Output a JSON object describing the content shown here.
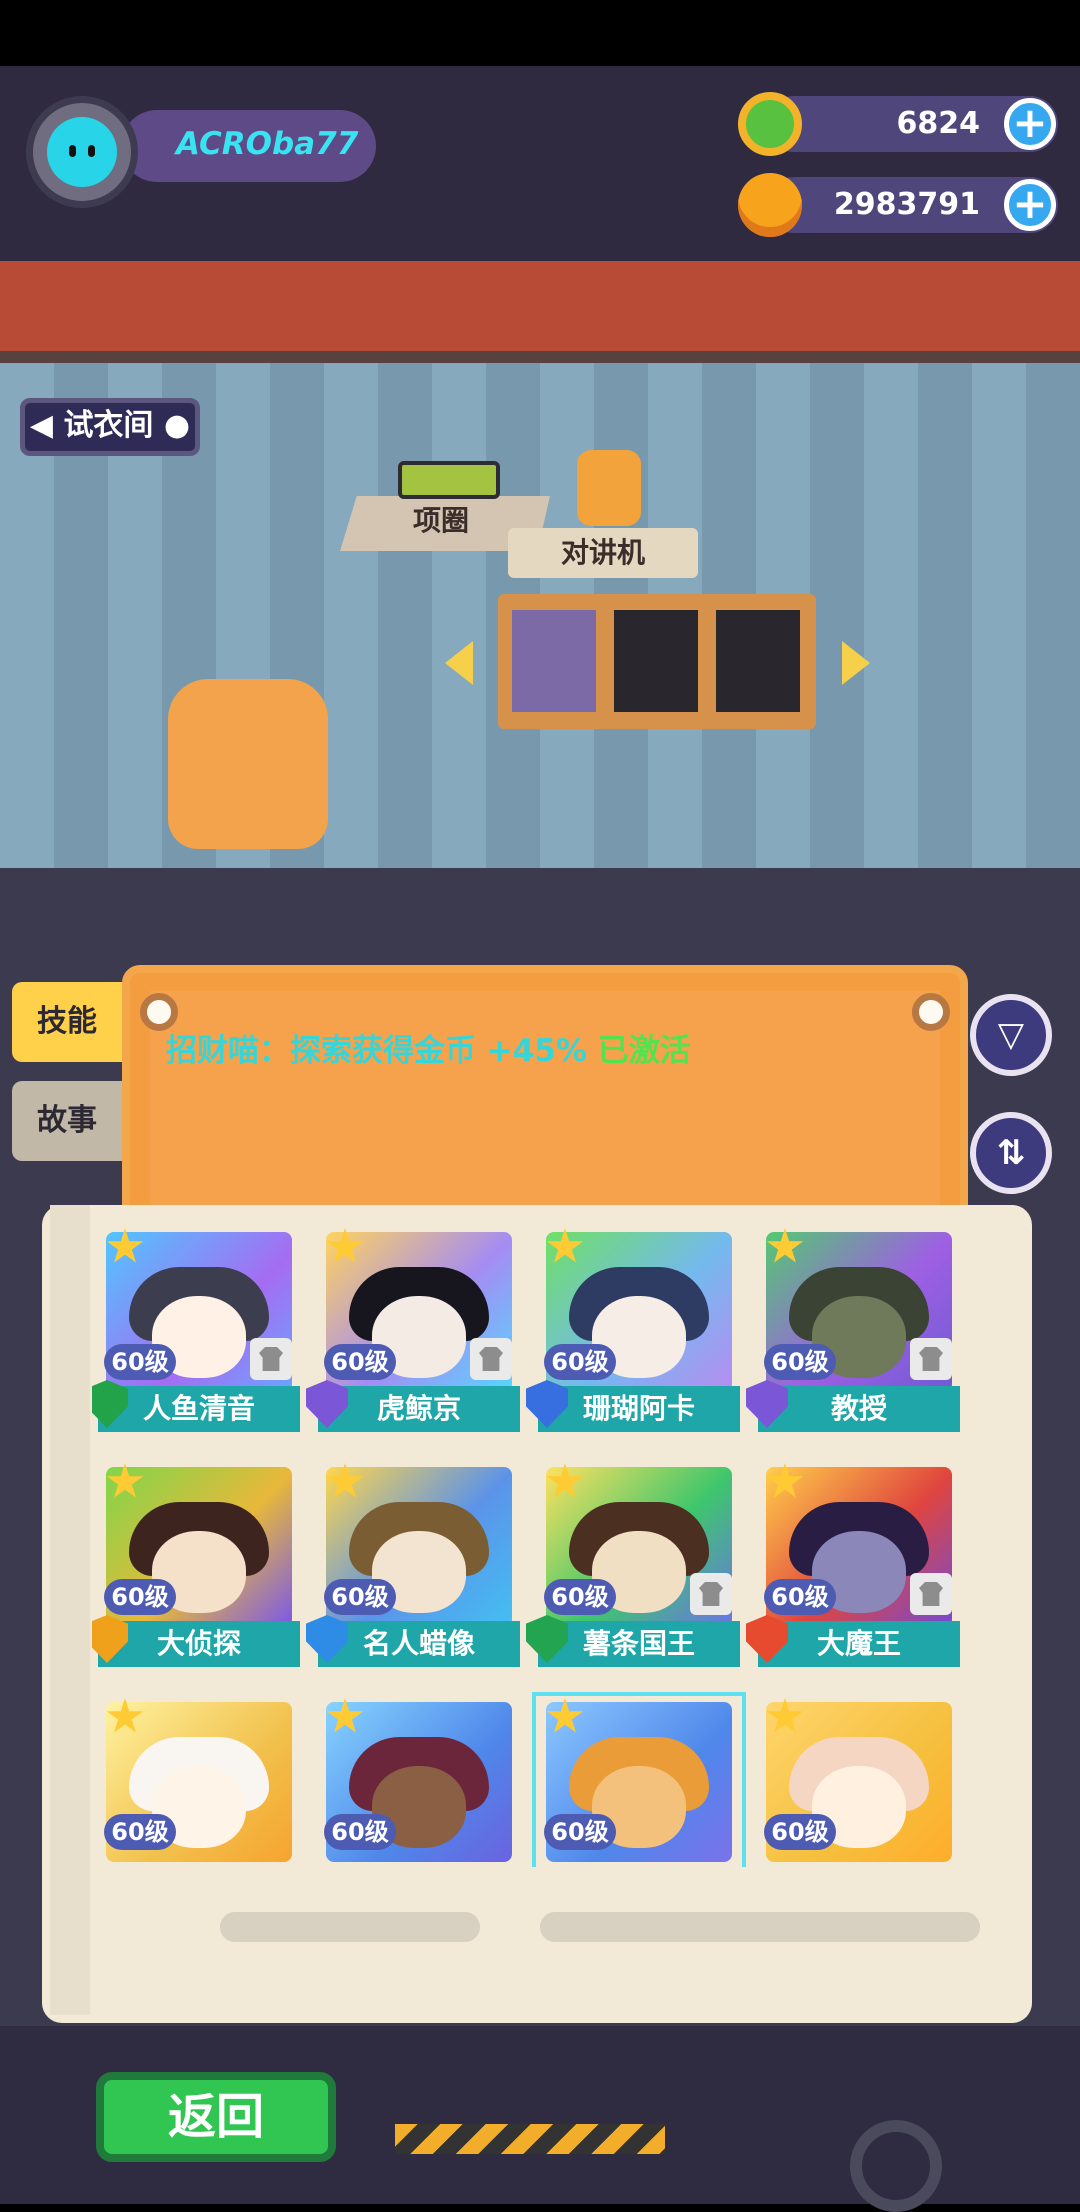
{
  "player": {
    "name": "ACROba77"
  },
  "resources": [
    {
      "value": "6824",
      "plus": "+"
    },
    {
      "value": "2983791",
      "plus": "+"
    }
  ],
  "room": {
    "mode_label": "试衣间",
    "accessory_labels": [
      "项圈",
      "对讲机"
    ]
  },
  "skill_tabs": [
    "技能",
    "故事"
  ],
  "skill": {
    "prefix": "招财喵：探索获得金币",
    "bonus": "+45%",
    "status": "已激活"
  },
  "controls": {
    "filter": "▽",
    "sort": "⇅"
  },
  "characters": [
    {
      "name": "人鱼清音",
      "level": "60级",
      "bg": "#6f7fe7",
      "badge": "#22a34a",
      "hair": "#3c3d4f",
      "face": "#fff1e5"
    },
    {
      "name": "虎鲸京",
      "level": "60级",
      "bg": "#a58cf2",
      "badge": "#7b57d8",
      "hair": "#17161e",
      "face": "#f4ebe5"
    },
    {
      "name": "珊瑚阿卡",
      "level": "60级",
      "bg": "#74b9ee",
      "badge": "#386fe0",
      "hair": "#2e3b63",
      "face": "#f6ede6"
    },
    {
      "name": "教授",
      "level": "60级",
      "bg": "#9e5fe3",
      "badge": "#7b57d8",
      "hair": "#3a4334",
      "face": "#6e7a59"
    },
    {
      "name": "大侦探",
      "level": "60级",
      "bg": "#e7b83a",
      "badge": "#f0a11b",
      "hair": "#3e241e",
      "face": "#f5e0ca"
    },
    {
      "name": "名人蜡像",
      "level": "60级",
      "bg": "#5c93e9",
      "badge": "#2e8be6",
      "hair": "#7b5d33",
      "face": "#f2e4d0"
    },
    {
      "name": "薯条国王",
      "level": "60级",
      "bg": "#3ec66c",
      "badge": "#23a451",
      "hair": "#4b2f20",
      "face": "#f1dfc4"
    },
    {
      "name": "大魔王",
      "level": "60级",
      "bg": "#e0453e",
      "badge": "#e64b2f",
      "hair": "#2a1d44",
      "face": "#8b88b9"
    },
    {
      "name": "",
      "level": "60级",
      "bg": "#f1c04b",
      "badge": "#f0a11b",
      "hair": "#f9f6f2",
      "face": "#fff4e8"
    },
    {
      "name": "",
      "level": "60级",
      "bg": "#4f87ea",
      "badge": "#7b57d8",
      "hair": "#6b263c",
      "face": "#8a5f43"
    },
    {
      "name": "",
      "level": "60级",
      "bg": "#4f87ea",
      "badge": "#f0a11b",
      "hair": "#e99c37",
      "face": "#f3c17b"
    },
    {
      "name": "",
      "level": "60级",
      "bg": "#f5bf3d",
      "badge": "#7b57d8",
      "hair": "#f5d6c2",
      "face": "#fff0e0"
    }
  ],
  "footer": {
    "back": "返回"
  },
  "colors": {
    "cyan": "#3ae3f1",
    "green": "#31c552",
    "orange": "#f39d40"
  }
}
